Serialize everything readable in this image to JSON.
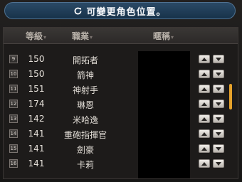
{
  "notice": {
    "text": "可變更角色位置。",
    "icon": "refresh-icon"
  },
  "header": {
    "level": "等級",
    "job": "職業",
    "nickname": "暱稱"
  },
  "rows": [
    {
      "index": "9",
      "level": "150",
      "job": "開拓者"
    },
    {
      "index": "10",
      "level": "150",
      "job": "箭神"
    },
    {
      "index": "11",
      "level": "151",
      "job": "神射手"
    },
    {
      "index": "12",
      "level": "174",
      "job": "琳恩"
    },
    {
      "index": "13",
      "level": "142",
      "job": "米哈逸"
    },
    {
      "index": "14",
      "level": "141",
      "job": "重砲指揮官"
    },
    {
      "index": "15",
      "level": "141",
      "job": "劍豪"
    },
    {
      "index": "16",
      "level": "141",
      "job": "卡莉"
    }
  ],
  "colors": {
    "accent": "#e6a22b",
    "notice_bg": "#17324a"
  }
}
